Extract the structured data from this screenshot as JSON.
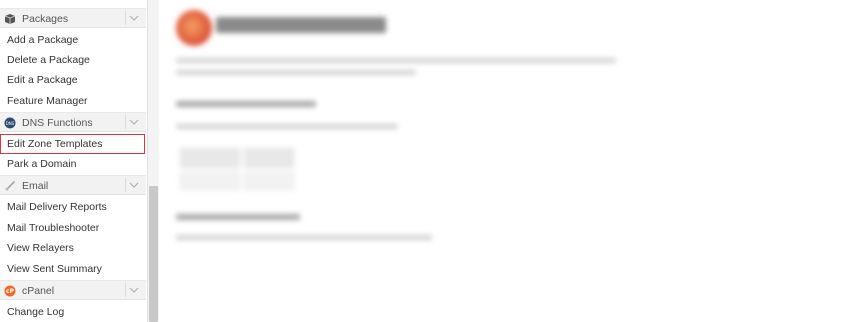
{
  "sidebar": {
    "sections": [
      {
        "label": "Packages",
        "icon": "package-icon"
      },
      {
        "label": "DNS Functions",
        "icon": "dns-icon"
      },
      {
        "label": "Email",
        "icon": "email-icon"
      },
      {
        "label": "cPanel",
        "icon": "cpanel-icon"
      }
    ],
    "items": {
      "add_package": "Add a Package",
      "delete_package": "Delete a Package",
      "edit_package": "Edit a Package",
      "feature_manager": "Feature Manager",
      "edit_zone_templates": "Edit Zone Templates",
      "park_domain": "Park a Domain",
      "mail_delivery_reports": "Mail Delivery Reports",
      "mail_troubleshooter": "Mail Troubleshooter",
      "view_relayers": "View Relayers",
      "view_sent_summary": "View Sent Summary",
      "change_log": "Change Log"
    },
    "active_item": "Edit Zone Templates",
    "colors": {
      "active_border": "#e0353d",
      "section_bg": "#f2f2f2"
    }
  }
}
